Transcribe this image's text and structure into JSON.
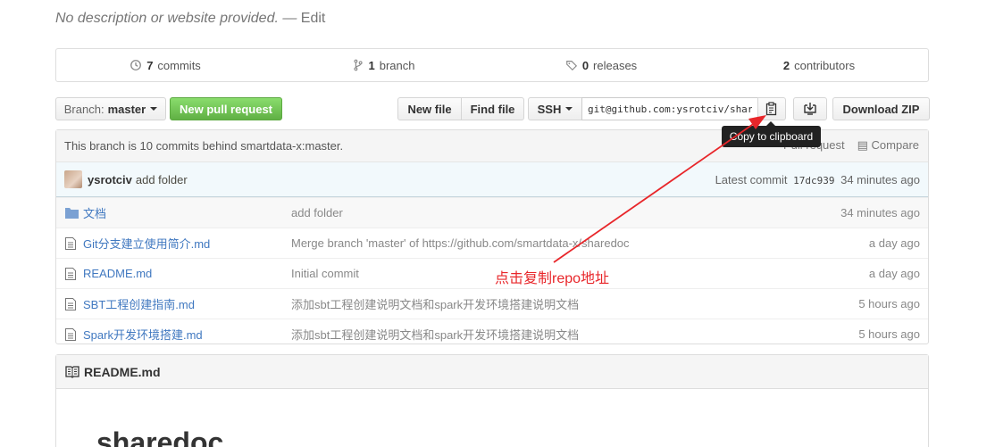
{
  "description": {
    "text": "No description or website provided.",
    "separator": " — ",
    "edit": "Edit"
  },
  "stats": {
    "commits": {
      "count": "7",
      "label": "commits"
    },
    "branches": {
      "count": "1",
      "label": "branch"
    },
    "releases": {
      "count": "0",
      "label": "releases"
    },
    "contributors": {
      "count": "2",
      "label": "contributors"
    }
  },
  "toolbar": {
    "branch_prefix": "Branch:",
    "branch_name": "master",
    "new_pull_request": "New pull request",
    "new_file": "New file",
    "find_file": "Find file",
    "protocol": "SSH",
    "clone_url": "git@github.com:ysrotciv/sharedoc.git",
    "download_zip": "Download ZIP",
    "tooltip": "Copy to clipboard"
  },
  "branch_status": {
    "text": "This branch is 10 commits behind smartdata-x:master.",
    "pull_request": "Pull request",
    "compare": "Compare"
  },
  "latest_commit": {
    "author": "ysrotciv",
    "message": "add folder",
    "label": "Latest commit",
    "sha": "17dc939",
    "age": "34 minutes ago"
  },
  "files": [
    {
      "name": "文档",
      "type": "dir",
      "message": "add folder",
      "age": "34 minutes ago"
    },
    {
      "name": "Git分支建立使用简介.md",
      "type": "file",
      "message": "Merge branch 'master' of https://github.com/smartdata-x/sharedoc",
      "age": "a day ago"
    },
    {
      "name": "README.md",
      "type": "file",
      "message": "Initial commit",
      "age": "a day ago"
    },
    {
      "name": "SBT工程创建指南.md",
      "type": "file",
      "message": "添加sbt工程创建说明文档和spark开发环境搭建说明文档",
      "age": "5 hours ago"
    },
    {
      "name": "Spark开发环境搭建.md",
      "type": "file",
      "message": "添加sbt工程创建说明文档和spark开发环境搭建说明文档",
      "age": "5 hours ago"
    }
  ],
  "readme": {
    "filename": "README.md",
    "title": "sharedoc"
  },
  "annotation": {
    "text": "点击复制repo地址",
    "color": "#e8262a"
  }
}
